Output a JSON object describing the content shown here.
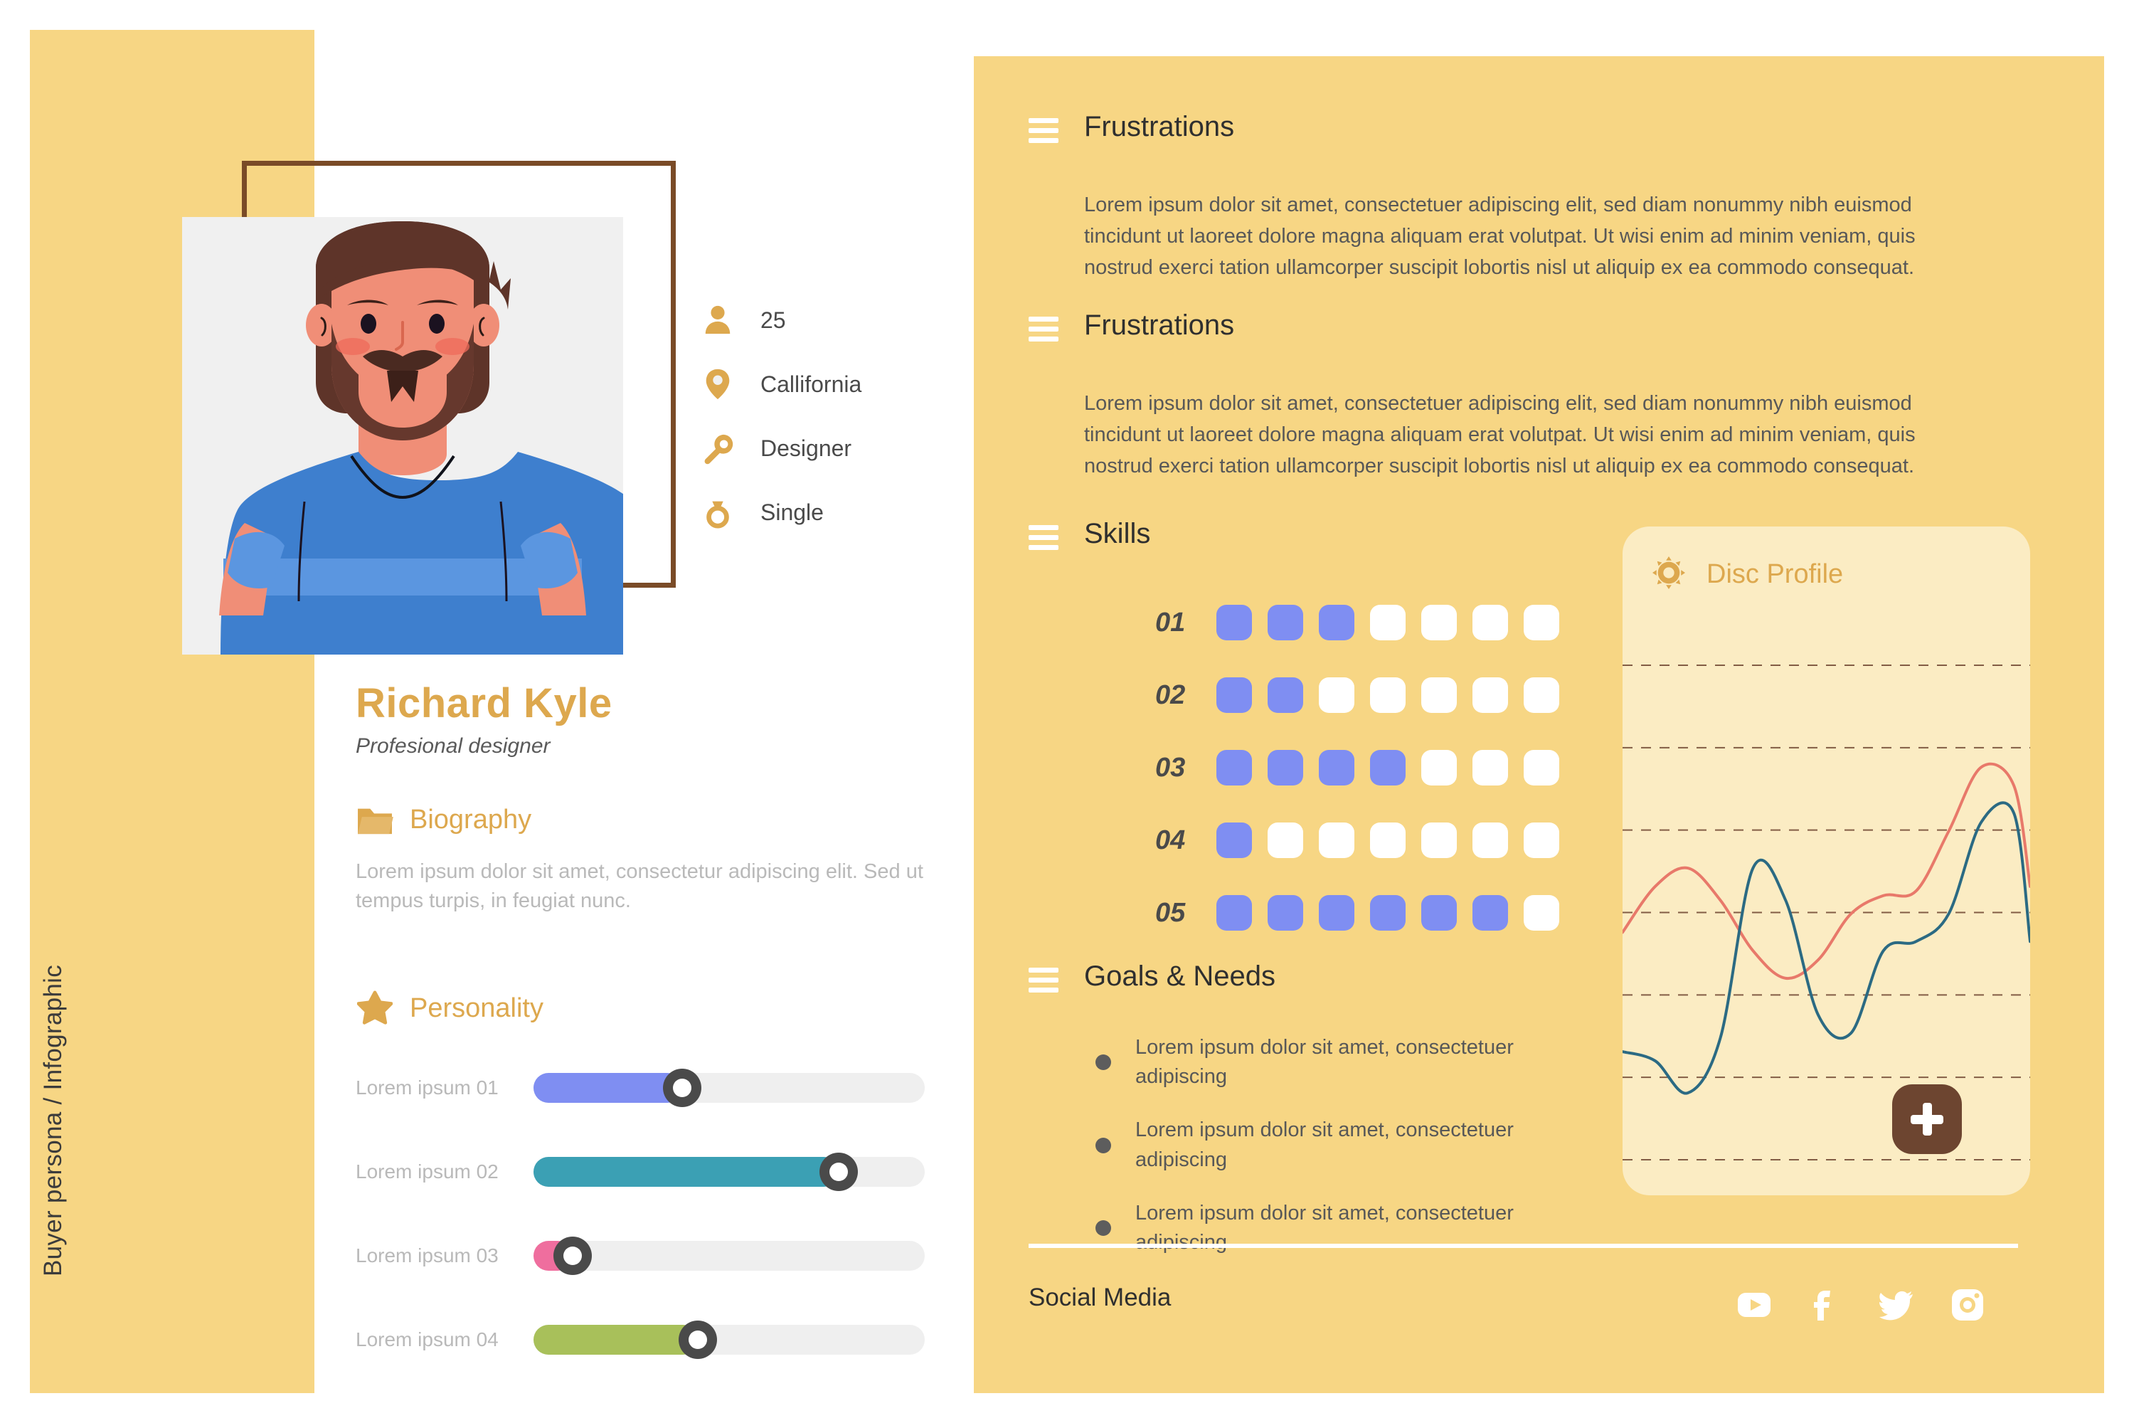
{
  "sidebar": {
    "vertical_label": "Buyer persona / Infographic"
  },
  "profile": {
    "name": "Richard Kyle",
    "role": "Profesional designer",
    "info": [
      {
        "icon": "user-icon",
        "value": "25"
      },
      {
        "icon": "location-pin-icon",
        "value": "Callifornia"
      },
      {
        "icon": "wrench-icon",
        "value": " Designer"
      },
      {
        "icon": "ring-icon",
        "value": "Single"
      }
    ]
  },
  "biography": {
    "icon": "folder-icon",
    "title": "Biography",
    "text": "Lorem ipsum dolor sit amet, consectetur adipiscing elit. Sed ut tempus turpis, in feugiat nunc."
  },
  "personality": {
    "icon": "star-icon",
    "title": "Personality",
    "sliders": [
      {
        "label": "Lorem ipsum 01",
        "value": 38,
        "color": "#7f8ef2"
      },
      {
        "label": "Lorem ipsum 02",
        "value": 78,
        "color": "#3ba0b4"
      },
      {
        "label": "Lorem ipsum 03",
        "value": 10,
        "color": "#ef6e9e"
      },
      {
        "label": "Lorem ipsum 04",
        "value": 42,
        "color": "#a8c05a"
      }
    ]
  },
  "frustrations": [
    {
      "title": "Frustrations",
      "text": "Lorem ipsum dolor sit amet, consectetuer adipiscing elit, sed diam nonummy nibh euismod tincidunt ut laoreet dolore magna aliquam erat volutpat. Ut wisi enim ad minim veniam, quis nostrud exerci tation ullamcorper suscipit lobortis nisl ut aliquip ex ea commodo consequat."
    },
    {
      "title": "Frustrations",
      "text": "Lorem ipsum dolor sit amet, consectetuer adipiscing elit, sed diam nonummy nibh euismod tincidunt ut laoreet dolore magna aliquam erat volutpat. Ut wisi enim ad minim veniam, quis nostrud exerci tation ullamcorper suscipit lobortis nisl ut aliquip ex ea commodo consequat."
    }
  ],
  "skills": {
    "title": "Skills",
    "total_cells": 7,
    "rows": [
      {
        "label": "01",
        "filled": 3
      },
      {
        "label": "02",
        "filled": 2
      },
      {
        "label": "03",
        "filled": 4
      },
      {
        "label": "04",
        "filled": 1
      },
      {
        "label": "05",
        "filled": 6
      }
    ]
  },
  "goals": {
    "title": "Goals & Needs",
    "items": [
      "Lorem ipsum dolor sit amet, consectetuer adipiscing",
      " Lorem ipsum dolor sit amet, consectetuer adipiscing",
      "Lorem ipsum dolor sit amet, consectetuer adipiscing"
    ]
  },
  "disc_profile": {
    "icon": "gear-icon",
    "title": "Disc Profile",
    "add_button": "+"
  },
  "social": {
    "label": "Social Media",
    "icons": [
      "youtube-icon",
      "facebook-icon",
      "twitter-icon",
      "instagram-icon"
    ]
  },
  "colors": {
    "panel_yellow": "#f7d684",
    "accent_gold": "#dda84e",
    "card_cream": "#fbecc3",
    "skill_blue": "#7f8ef2",
    "brown": "#6d4530",
    "chart_red": "#e8796a",
    "chart_teal": "#2b6a83"
  },
  "chart_data": {
    "type": "line",
    "title": "Disc Profile",
    "xlabel": "",
    "ylabel": "",
    "grid": true,
    "gridlines": 7,
    "legend": "none",
    "xlim": [
      0,
      100
    ],
    "ylim": [
      0,
      100
    ],
    "series": [
      {
        "name": "red-line",
        "color": "#e8796a",
        "x": [
          0,
          8,
          16,
          24,
          32,
          40,
          48,
          56,
          64,
          72,
          80,
          88,
          96,
          100
        ],
        "values": [
          48,
          58,
          62,
          55,
          44,
          38,
          42,
          52,
          56,
          57,
          70,
          84,
          80,
          58
        ]
      },
      {
        "name": "teal-line",
        "color": "#2b6a83",
        "x": [
          0,
          8,
          16,
          24,
          32,
          40,
          48,
          56,
          64,
          72,
          80,
          88,
          96,
          100
        ],
        "values": [
          22,
          20,
          13,
          25,
          62,
          55,
          30,
          26,
          44,
          46,
          52,
          72,
          74,
          46
        ]
      }
    ]
  }
}
